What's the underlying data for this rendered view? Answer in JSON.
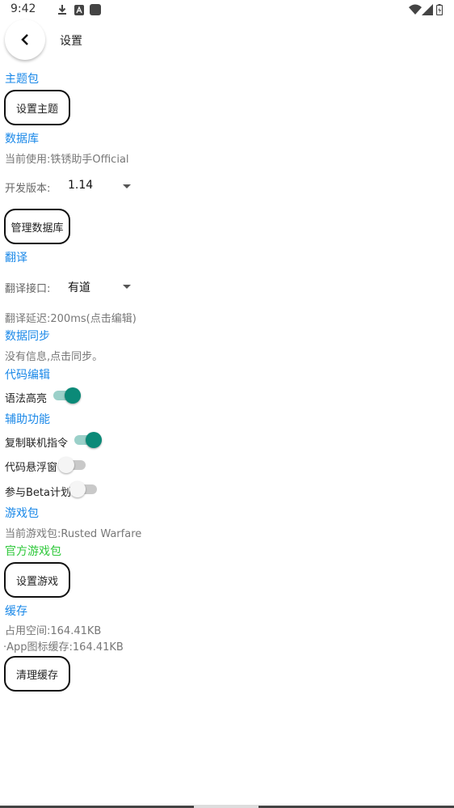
{
  "status_bar": {
    "time": "9:42",
    "icons": [
      "download-icon",
      "font-a-icon",
      "square-app-icon",
      "wifi-icon",
      "signal-icon",
      "battery-icon"
    ]
  },
  "app_bar": {
    "title": "设置",
    "back_icon": "chevron-left-icon"
  },
  "theme": {
    "section": "主题包",
    "button": "设置主题"
  },
  "database": {
    "section": "数据库",
    "current": "当前使用:铁锈助手Official",
    "version_label": "开发版本:",
    "version_value": "1.14",
    "manage_button": "管理数据库"
  },
  "translate": {
    "section": "翻译",
    "api_label": "翻译接口:",
    "api_value": "有道",
    "delay": "翻译延迟:200ms(点击编辑)"
  },
  "sync": {
    "section": "数据同步",
    "info": "没有信息,点击同步。"
  },
  "code_edit": {
    "section": "代码编辑",
    "highlight_label": "语法高亮",
    "highlight_on": true
  },
  "assist": {
    "section": "辅助功能",
    "copy_cmd_label": "复制联机指令",
    "copy_cmd_on": true,
    "float_label": "代码悬浮窗",
    "float_on": false,
    "beta_label": "参与Beta计划",
    "beta_on": false
  },
  "game_pack": {
    "section": "游戏包",
    "current": "当前游戏包:Rusted Warfare",
    "official": "官方游戏包",
    "button": "设置游戏"
  },
  "cache": {
    "section": "缓存",
    "used": "占用空间:164.41KB",
    "icon_cache": "·App图标缓存:164.41KB",
    "button": "清理缓存"
  },
  "colors": {
    "section": "#1a88e8",
    "official": "#2ec83a",
    "switch_on": "#0b8a78"
  }
}
